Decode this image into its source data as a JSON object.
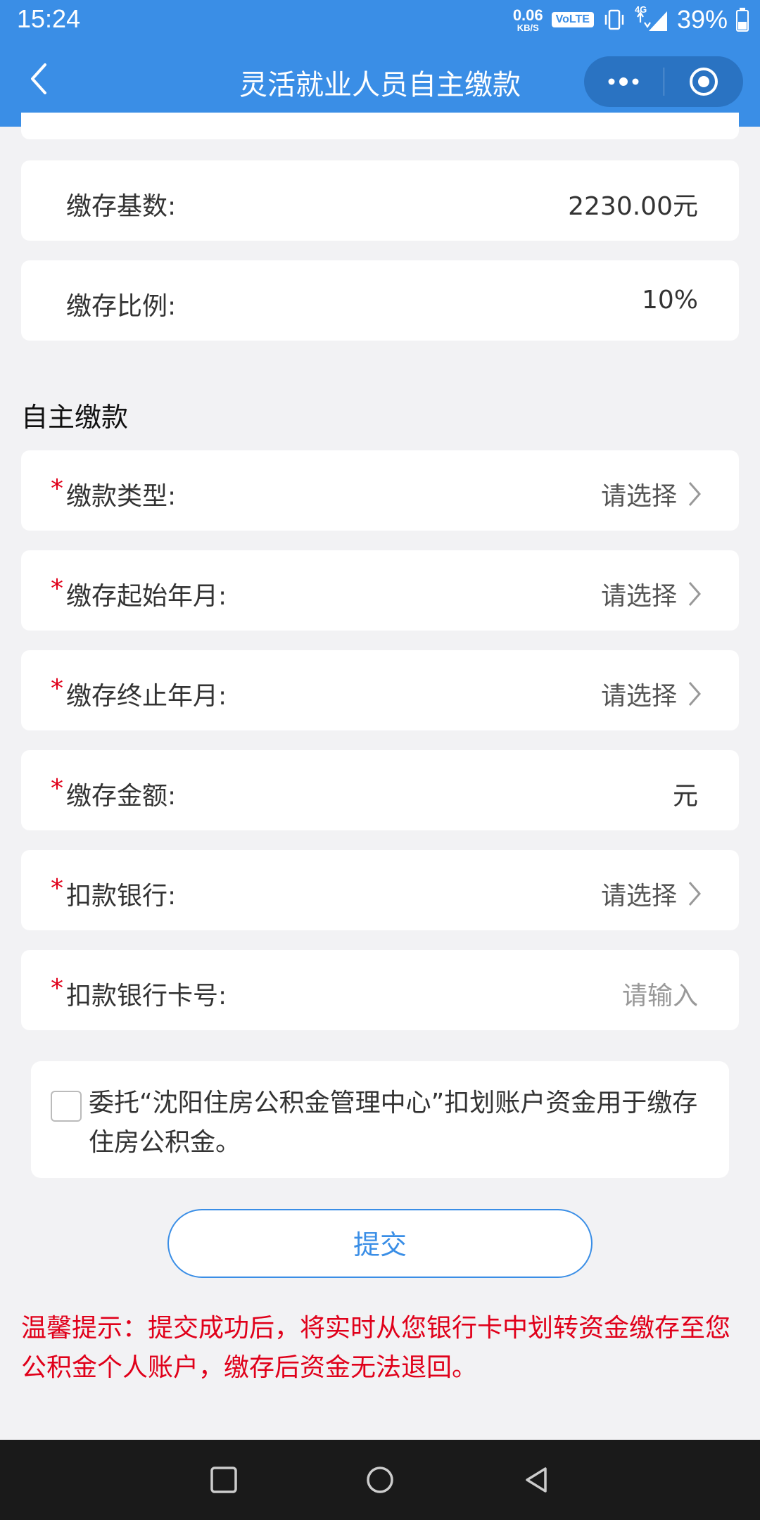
{
  "status_bar": {
    "time": "15:24",
    "net_speed_value": "0.06",
    "net_speed_unit": "KB/S",
    "volte": "VoLTE",
    "network": "4G",
    "battery": "39%"
  },
  "nav": {
    "title": "灵活就业人员自主缴款",
    "back_icon": "chevron-left-icon",
    "menu_icon": "more-dots-icon",
    "close_icon": "target-circle-icon"
  },
  "info": {
    "base_label": "缴存基数:",
    "base_value": "2230.00元",
    "ratio_label": "缴存比例:",
    "ratio_value": "10%"
  },
  "section_title": "自主缴款",
  "form": {
    "required_mark": "*",
    "type_label": "缴款类型:",
    "type_value": "请选择",
    "start_label": "缴存起始年月:",
    "start_value": "请选择",
    "end_label": "缴存终止年月:",
    "end_value": "请选择",
    "amount_label": "缴存金额:",
    "amount_unit": "元",
    "bank_label": "扣款银行:",
    "bank_value": "请选择",
    "card_label": "扣款银行卡号:",
    "card_placeholder": "请输入"
  },
  "consent": {
    "text": "委托“沈阳住房公积金管理中心”扣划账户资金用于缴存住房公积金。",
    "checked": false
  },
  "submit_label": "提交",
  "tip": "温馨提示：提交成功后，将实时从您银行卡中划转资金缴存至您公积金个人账户，缴存后资金无法退回。",
  "colors": {
    "primary": "#3a8ee6",
    "required": "#e0001a",
    "background": "#f2f2f4"
  }
}
